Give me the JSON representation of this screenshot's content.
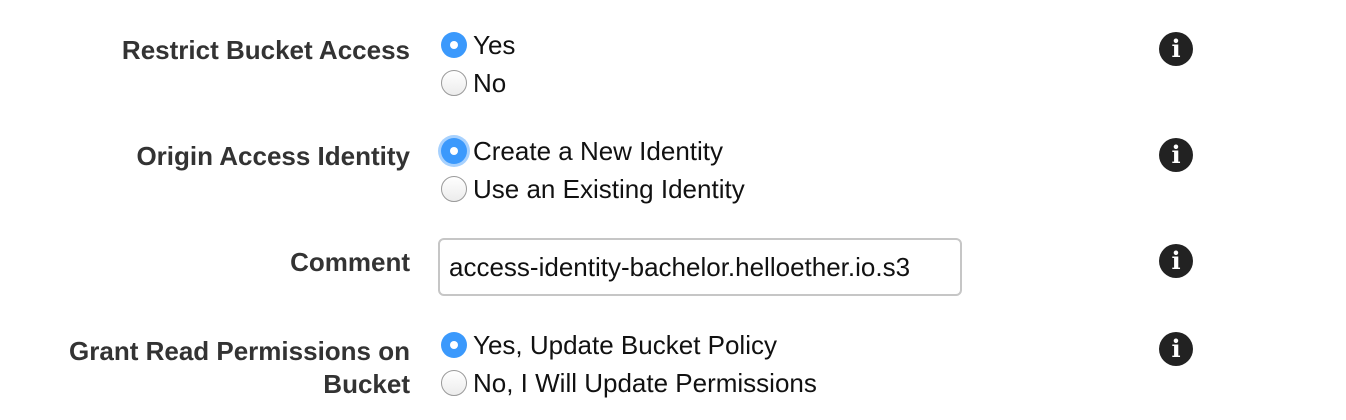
{
  "form": {
    "restrict_bucket_access": {
      "label": "Restrict Bucket Access",
      "options": [
        {
          "label": "Yes",
          "selected": true
        },
        {
          "label": "No",
          "selected": false
        }
      ],
      "info_icon": "info-icon"
    },
    "origin_access_identity": {
      "label": "Origin Access Identity",
      "options": [
        {
          "label": "Create a New Identity",
          "selected": true
        },
        {
          "label": "Use an Existing Identity",
          "selected": false
        }
      ],
      "info_icon": "info-icon"
    },
    "comment": {
      "label": "Comment",
      "value": "access-identity-bachelor.helloether.io.s3",
      "info_icon": "info-icon"
    },
    "grant_read_permissions": {
      "label_line1": "Grant Read Permissions on",
      "label_line2": "Bucket",
      "options": [
        {
          "label": "Yes, Update Bucket Policy",
          "selected": true
        },
        {
          "label": "No, I Will Update Permissions",
          "selected": false
        }
      ],
      "info_icon": "info-icon"
    }
  },
  "colors": {
    "accent": "#3b99fc",
    "label": "#333333",
    "info_icon_bg": "#222222"
  }
}
